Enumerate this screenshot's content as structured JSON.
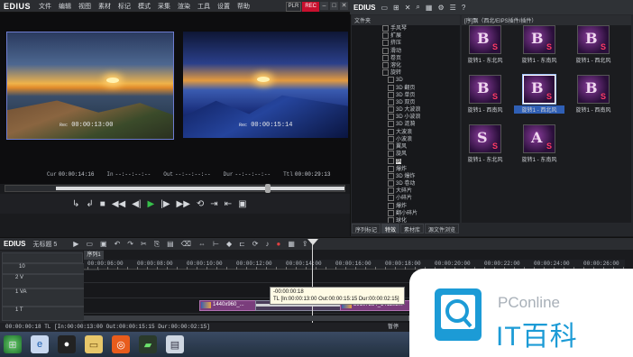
{
  "app": {
    "name": "EDIUS",
    "mode": [
      "PLR",
      "REC"
    ]
  },
  "menu": [
    "文件",
    "编辑",
    "视图",
    "素材",
    "标记",
    "模式",
    "采集",
    "渲染",
    "工具",
    "设置",
    "帮助"
  ],
  "preview": {
    "tc_left": "00:00:13:00",
    "tc_right": "00:00:15:14",
    "tc_prefix": "Rec",
    "bar": [
      {
        "label": "Cur",
        "value": "00:00:14:16"
      },
      {
        "label": "In",
        "value": "--:--:--:--"
      },
      {
        "label": "Out",
        "value": "--:--:--:--"
      },
      {
        "label": "Dur",
        "value": "--:--:--:--"
      },
      {
        "label": "Ttl",
        "value": "00:00:29:13"
      }
    ]
  },
  "bin": {
    "title": "EDIUS",
    "tree_header": "文件夹",
    "tree": [
      {
        "label": "手风琴",
        "sel": false
      },
      {
        "label": "扩展",
        "sel": false
      },
      {
        "label": "挤压",
        "sel": false
      },
      {
        "label": "滑动",
        "sel": false
      },
      {
        "label": "卷页",
        "sel": false
      },
      {
        "label": "溶化",
        "sel": false
      },
      {
        "label": "旋转",
        "sel": false
      },
      {
        "label": "3D",
        "sel": false
      },
      {
        "label": "3D 翻页",
        "sel": false
      },
      {
        "label": "3D 单页",
        "sel": false
      },
      {
        "label": "3D 双页",
        "sel": false
      },
      {
        "label": "3D 大波浪",
        "sel": false
      },
      {
        "label": "3D 小波浪",
        "sel": false
      },
      {
        "label": "3D 涟漪",
        "sel": false
      },
      {
        "label": "大波浪",
        "sel": false
      },
      {
        "label": "小波浪",
        "sel": false
      },
      {
        "label": "翼风",
        "sel": false
      },
      {
        "label": "旋风",
        "sel": false
      },
      {
        "label": "飘",
        "sel": true
      },
      {
        "label": "爆炸",
        "sel": false
      },
      {
        "label": "3D 爆炸",
        "sel": false
      },
      {
        "label": "3D 卷动",
        "sel": false
      },
      {
        "label": "大碎片",
        "sel": false
      },
      {
        "label": "小碎片",
        "sel": false
      },
      {
        "label": "爆炸",
        "sel": false
      },
      {
        "label": "翻小碎片",
        "sel": false
      },
      {
        "label": "球化",
        "sel": false
      },
      {
        "label": "3D",
        "sel": false
      }
    ],
    "grid_header": "[序]飘（西北/EIPS插件/插件）",
    "tiles": [
      {
        "caption": "旋转1 - 东北风",
        "sel": false
      },
      {
        "caption": "旋转1 - 东南风",
        "sel": false
      },
      {
        "caption": "旋转1 - 西北风",
        "sel": false
      },
      {
        "caption": "旋转1 - 西南风",
        "sel": false
      },
      {
        "caption": "旋转1 - 西北风",
        "sel": true
      },
      {
        "caption": "旋转1 - 西南风",
        "sel": false
      },
      {
        "caption": "旋转1 - 东北风",
        "sel": false
      },
      {
        "caption": "旋转1 - 东南风",
        "sel": false
      }
    ],
    "tabs": [
      {
        "label": "序列标记",
        "active": false
      },
      {
        "label": "特效",
        "active": true
      },
      {
        "label": "素材库",
        "active": false
      },
      {
        "label": "源文件浏览",
        "active": false
      }
    ]
  },
  "timeline": {
    "title": "EDIUS",
    "project": "无标题 5",
    "seq_tab": "序列1",
    "ruler": [
      "00:00:06:00",
      "00:00:08:00",
      "00:00:10:00",
      "00:00:12:00",
      "00:00:14:00",
      "00:00:16:00",
      "00:00:18:00",
      "00:00:20:00",
      "00:00:22:00",
      "00:00:24:00",
      "00:00:26:00"
    ],
    "tracks": [
      {
        "name": "10",
        "label": "",
        "y": 0
      },
      {
        "name": "2 V",
        "label": "",
        "y": 1
      },
      {
        "name": "1 VA",
        "label": "",
        "y": 2
      },
      {
        "name": "1 T",
        "label": "",
        "y": 3
      }
    ],
    "clips": [
      {
        "label": "1440x960_...",
        "kind": "a"
      },
      {
        "label": "39107284_141105...",
        "kind": "a"
      }
    ],
    "tooltip_line1": "-00:00:00:18",
    "tooltip_line2": "TL [In:00:00:13:00 Out:00:00:15:15 Dur:00:00:02:15]"
  },
  "status": {
    "text": "00:00:00:18 TL [In:00:00:13:00 Out:00:00:15:15 Dur:00:00:02:15]",
    "right": "暂停"
  },
  "watermark": {
    "line1": "PConline",
    "line2": "IT百科"
  }
}
